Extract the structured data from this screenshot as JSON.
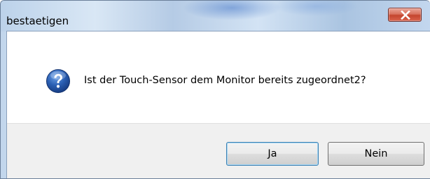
{
  "window": {
    "title": "bestaetigen",
    "close_icon": "close-icon"
  },
  "dialog": {
    "icon": "question-icon",
    "message": "Ist der Touch-Sensor dem Monitor bereits zugeordnet2?"
  },
  "buttons": {
    "yes_label": "Ja",
    "no_label": "Nein"
  },
  "colors": {
    "close_button": "#c4452e",
    "question_icon": "#2a5fb3",
    "button_area": "#f0f0f0"
  }
}
